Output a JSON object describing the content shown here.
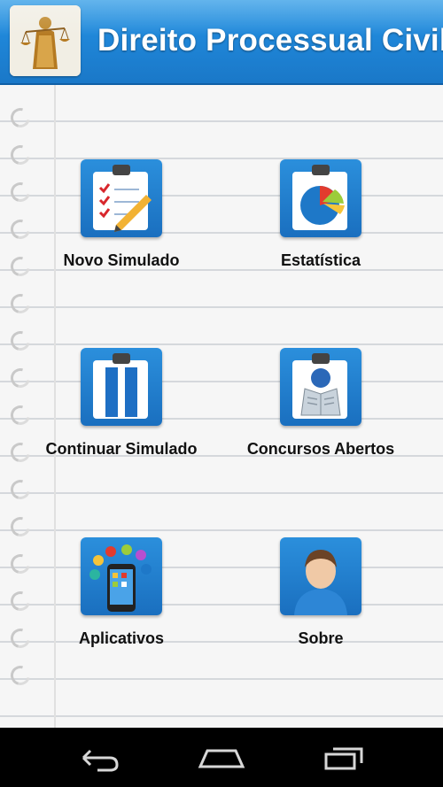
{
  "app": {
    "title": "Direito Processual Civil",
    "logo_icon": "justice-statue-icon"
  },
  "colors": {
    "header_blue": "#1f86d8",
    "tile_blue": "#1a6fbf",
    "paper_bg": "#f6f6f6"
  },
  "menu": [
    {
      "label": "Novo Simulado",
      "icon": "clipboard-checklist-icon"
    },
    {
      "label": "Estatística",
      "icon": "pie-chart-icon"
    },
    {
      "label": "Continuar Simulado",
      "icon": "pause-icon"
    },
    {
      "label": "Concursos Abertos",
      "icon": "newspaper-reader-icon"
    },
    {
      "label": "Aplicativos",
      "icon": "smartphone-apps-icon"
    },
    {
      "label": "Sobre",
      "icon": "user-profile-icon"
    }
  ],
  "navbar": {
    "back": "back-arrow-icon",
    "home": "home-icon",
    "recents": "recent-apps-icon"
  }
}
